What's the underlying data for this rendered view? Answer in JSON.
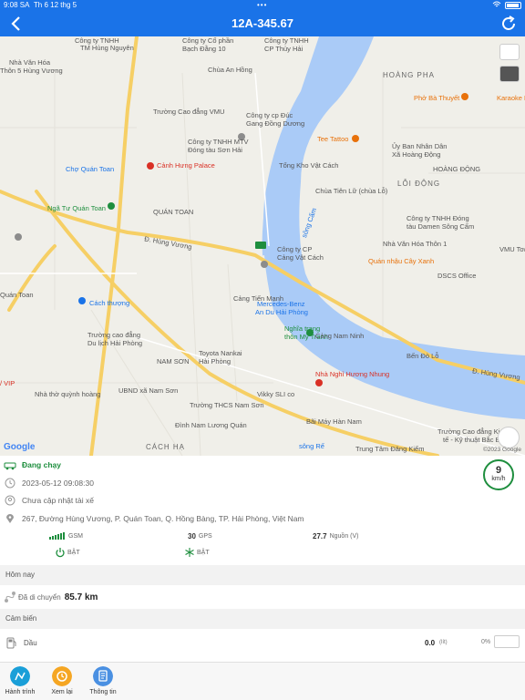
{
  "status_bar": {
    "time": "9:08 SA",
    "date": "Th 6 12 thg 5",
    "dots": "•••"
  },
  "navbar": {
    "title": "12A-345.67"
  },
  "map": {
    "labels": [
      {
        "text": "Công ty TNHH",
        "cls": ""
      },
      {
        "text": "TM Hùng Nguyên",
        "cls": ""
      },
      {
        "text": "Công ty Cổ phần",
        "cls": ""
      },
      {
        "text": "Bạch Đằng 10",
        "cls": ""
      },
      {
        "text": "Công ty TNHH",
        "cls": ""
      },
      {
        "text": "CP Thủy Hải",
        "cls": ""
      },
      {
        "text": "Nhà Văn Hóa",
        "cls": ""
      },
      {
        "text": "Thôn 5 Hùng Vương",
        "cls": ""
      },
      {
        "text": "Chùa An Hồng",
        "cls": ""
      },
      {
        "text": "HOÀNG PHA",
        "cls": "big"
      },
      {
        "text": "Phở Bà Thuyết",
        "cls": "orange"
      },
      {
        "text": "Karaoke L",
        "cls": "orange"
      },
      {
        "text": "Trường Cao đẳng VMU",
        "cls": ""
      },
      {
        "text": "Công ty cp Đúc",
        "cls": ""
      },
      {
        "text": "Gang Đồng Dương",
        "cls": ""
      },
      {
        "text": "Tee Tattoo",
        "cls": "orange"
      },
      {
        "text": "Ủy Ban Nhân Dân",
        "cls": ""
      },
      {
        "text": "Xã Hoàng Động",
        "cls": ""
      },
      {
        "text": "Công ty TNHH MTV",
        "cls": ""
      },
      {
        "text": "Đóng tàu Sơn Hải",
        "cls": ""
      },
      {
        "text": "Tổng Kho Vật Cách",
        "cls": ""
      },
      {
        "text": "HOÀNG ĐỘNG",
        "cls": ""
      },
      {
        "text": "Chợ Quán Toan",
        "cls": "blue"
      },
      {
        "text": "Cảnh Hưng Palace",
        "cls": "red"
      },
      {
        "text": "LỖI ĐỘNG",
        "cls": "big"
      },
      {
        "text": "Chùa Tiên Lữ (chùa Lỗ)",
        "cls": ""
      },
      {
        "text": "Ngã Tư Quán Toan",
        "cls": "green"
      },
      {
        "text": "QUÁN TOAN",
        "cls": ""
      },
      {
        "text": "Công ty TNHH Đóng",
        "cls": ""
      },
      {
        "text": "tàu Damen Sông Cấm",
        "cls": ""
      },
      {
        "text": "Đ. Hùng Vương",
        "cls": ""
      },
      {
        "text": "Công ty CP",
        "cls": ""
      },
      {
        "text": "Cảng Vật Cách",
        "cls": ""
      },
      {
        "text": "Nhà Văn Hóa Thôn 1",
        "cls": ""
      },
      {
        "text": "VMU Tow",
        "cls": ""
      },
      {
        "text": "Quán nhậu Cây Xanh",
        "cls": "orange"
      },
      {
        "text": "DSCS Office",
        "cls": ""
      },
      {
        "text": "Cảng Tiến Mạnh",
        "cls": ""
      },
      {
        "text": "Cách thượng",
        "cls": "blue"
      },
      {
        "text": "Quán Toan",
        "cls": ""
      },
      {
        "text": "Mercedes-Benz",
        "cls": "blue"
      },
      {
        "text": "An Du Hải Phòng",
        "cls": "blue"
      },
      {
        "text": "Nghĩa trang",
        "cls": "green"
      },
      {
        "text": "thôn Mỹ Tranh",
        "cls": "green"
      },
      {
        "text": "Trường cao đẳng",
        "cls": ""
      },
      {
        "text": "Du lịch Hải Phòng",
        "cls": ""
      },
      {
        "text": "Cảng Nam Ninh",
        "cls": ""
      },
      {
        "text": "Bến Đò Lỗ",
        "cls": ""
      },
      {
        "text": "Toyota Nankai",
        "cls": ""
      },
      {
        "text": "Hải Phòng",
        "cls": ""
      },
      {
        "text": "NAM SƠN",
        "cls": ""
      },
      {
        "text": "Nhà Nghỉ Hương Nhung",
        "cls": "red"
      },
      {
        "text": "Đ. Hùng Vương",
        "cls": ""
      },
      {
        "text": "Nhà thờ quỳnh hoàng",
        "cls": ""
      },
      {
        "text": "UBND xã Nam Sơn",
        "cls": ""
      },
      {
        "text": "Vikky SLI co",
        "cls": ""
      },
      {
        "text": "Trường THCS Nam Sơn",
        "cls": ""
      },
      {
        "text": "Bãi Máy Hàn Nam",
        "cls": ""
      },
      {
        "text": "Đình Nam Lương Quán",
        "cls": ""
      },
      {
        "text": "Trường Cao đẳng Kinh",
        "cls": ""
      },
      {
        "text": "tế - Kỹ thuật Bắc B",
        "cls": ""
      },
      {
        "text": "CÁCH HẠ",
        "cls": "big"
      },
      {
        "text": "Trung Tâm Đăng Kiểm",
        "cls": ""
      },
      {
        "text": "sông Cấm",
        "cls": "blue"
      },
      {
        "text": "sông Rế",
        "cls": "blue"
      },
      {
        "text": "/ VIP",
        "cls": "red"
      }
    ],
    "google": "Google",
    "copyright": "©2023 Google"
  },
  "info": {
    "status": "Đang chạy",
    "timestamp": "2023-05-12 09:08:30",
    "driver": "Chưa cập nhật tài xế",
    "address": "267, Đường Hùng Vương, P. Quán Toan, Q. Hồng Bàng, TP. Hải Phòng, Việt Nam",
    "speed_value": "9",
    "speed_unit": "km/h",
    "gsm_label": "GSM",
    "gps_value": "30",
    "gps_label": "GPS",
    "power_value": "27.7",
    "power_label": "Nguồn (V)",
    "engine_state": "BẬT",
    "ac_state": "BẬT"
  },
  "today": {
    "header": "Hôm nay",
    "distance_label": "Đã di chuyển",
    "distance_value": "85.7 km"
  },
  "sensors": {
    "header": "Cảm biến",
    "items": [
      {
        "name": "Dầu",
        "value": "0.0",
        "unit": "(lít)",
        "percent": "0%"
      }
    ]
  },
  "tabs": [
    {
      "label": "Hành trình",
      "color": "#1a9fd8"
    },
    {
      "label": "Xem lại",
      "color": "#f5a623"
    },
    {
      "label": "Thông tin",
      "color": "#4a90e2"
    }
  ],
  "colors": {
    "accent": "#1a73e8",
    "running": "#1e8e3e",
    "river": "#aacbf7",
    "road": "#f6cf65"
  }
}
